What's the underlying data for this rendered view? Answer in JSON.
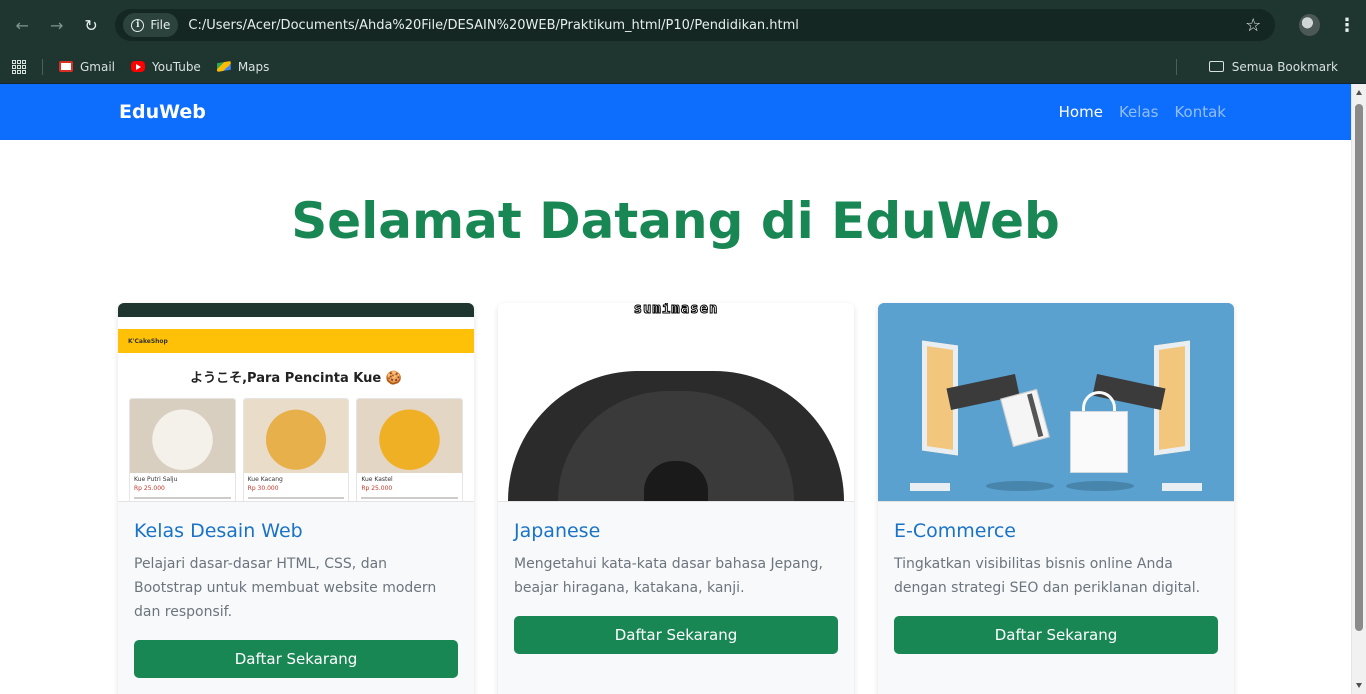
{
  "browser": {
    "file_chip": "File",
    "url": "C:/Users/Acer/Documents/Ahda%20File/DESAIN%20WEB/Praktikum_html/P10/Pendidikan.html",
    "bookmarks": [
      "Gmail",
      "YouTube",
      "Maps"
    ],
    "all_bookmarks": "Semua Bookmark"
  },
  "site": {
    "brand": "EduWeb",
    "nav": [
      "Home",
      "Kelas",
      "Kontak"
    ],
    "hero_title": "Selamat Datang di EduWeb"
  },
  "cards": [
    {
      "title": "Kelas Desain Web",
      "text": "Pelajari dasar-dasar HTML, CSS, dan Bootstrap untuk membuat website modern dan responsif.",
      "button": "Daftar Sekarang",
      "image": {
        "nav_brand": "K'CakeShop",
        "heading": "ようこそ,Para Pencinta Kue 🍪",
        "items": [
          {
            "name": "Kue Putri Salju",
            "price": "Rp 25.000"
          },
          {
            "name": "Kue Kacang",
            "price": "Rp 30.000"
          },
          {
            "name": "Kue Kastel",
            "price": "Rp 25.000"
          }
        ]
      }
    },
    {
      "title": "Japanese",
      "text": "Mengetahui kata-kata dasar bahasa Jepang, beajar hiragana, katakana, kanji.",
      "button": "Daftar Sekarang",
      "image": {
        "caption": "sumimasen"
      }
    },
    {
      "title": "E-Commerce",
      "text": "Tingkatkan visibilitas bisnis online Anda dengan strategi SEO dan periklanan digital.",
      "button": "Daftar Sekarang"
    }
  ],
  "colors": {
    "navbar": "#0d6efd",
    "hero": "#198754",
    "button": "#198754"
  }
}
